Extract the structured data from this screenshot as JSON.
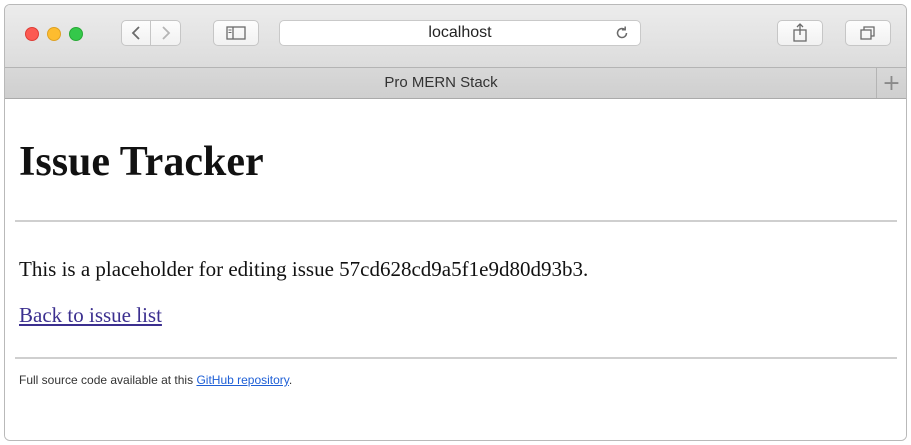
{
  "browser": {
    "address": "localhost",
    "tab_title": "Pro MERN Stack",
    "new_tab_label": "+",
    "colors": {
      "close": "#fc5a52",
      "minimize": "#fdbc2f",
      "zoom": "#34c84a"
    },
    "icons": [
      "back-icon",
      "forward-icon",
      "sidebar-icon",
      "reload-icon",
      "share-icon",
      "tabs-overview-icon"
    ]
  },
  "page": {
    "title": "Issue Tracker",
    "placeholder_text": "This is a placeholder for editing issue 57cd628cd9a5f1e9d80d93b3.",
    "back_link": "Back to issue list",
    "footer": {
      "prefix": "Full source code available at this ",
      "link": "GitHub repository",
      "suffix": "."
    }
  }
}
